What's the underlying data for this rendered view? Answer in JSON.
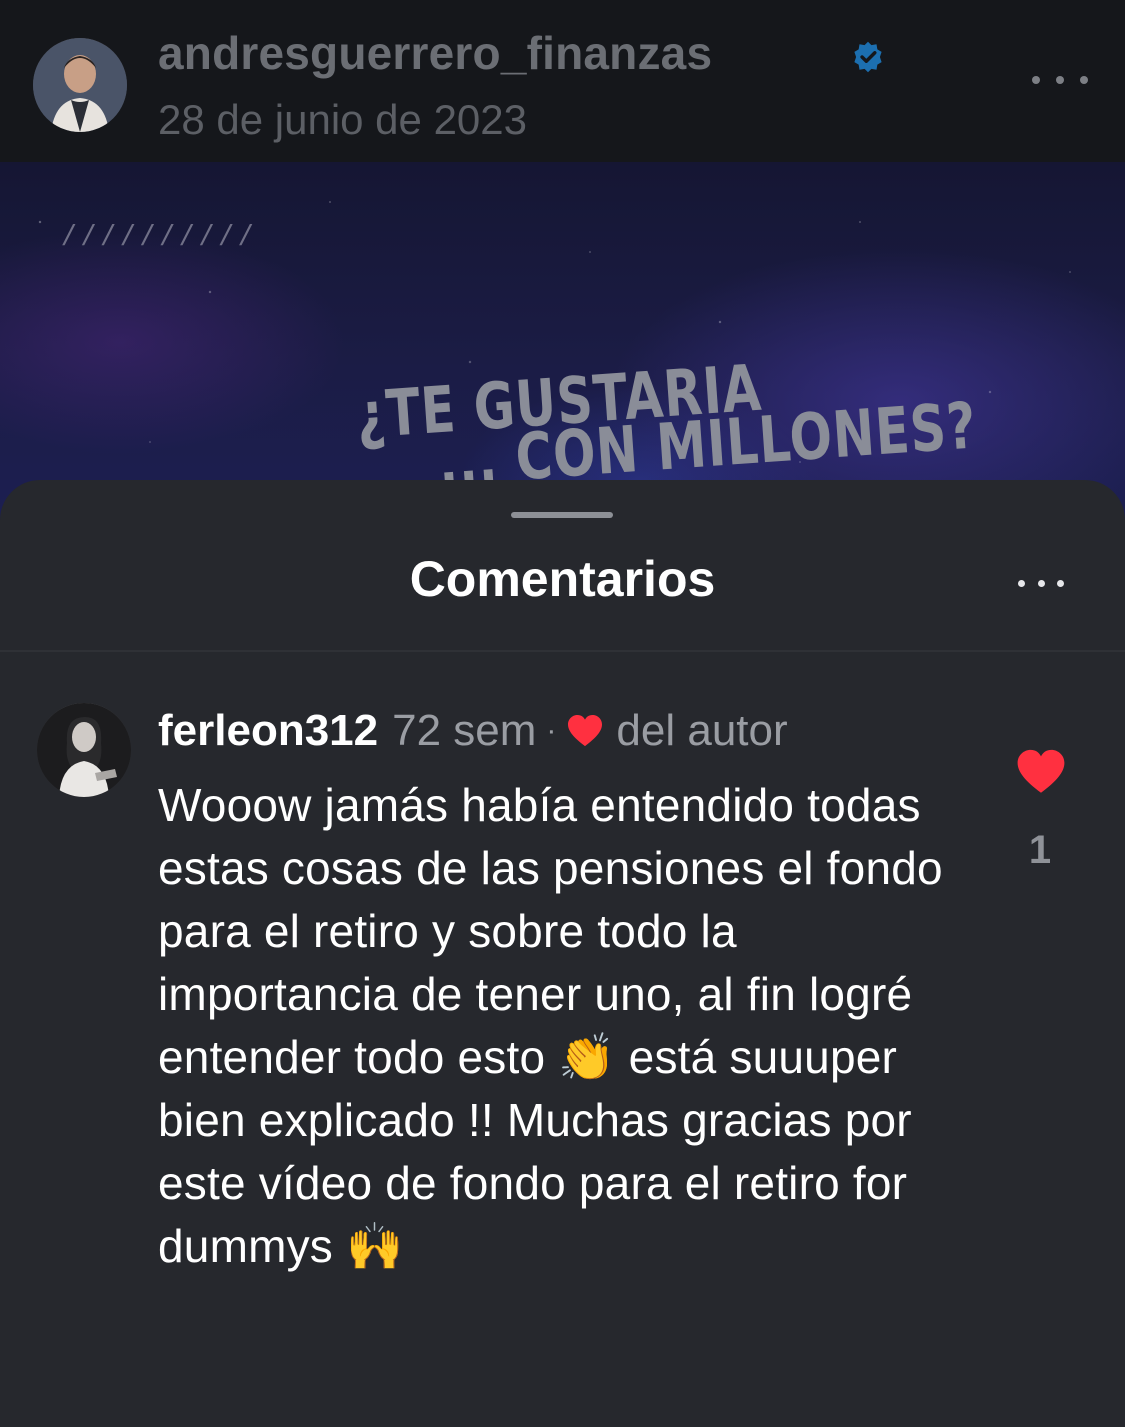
{
  "post": {
    "author": "andresguerrero_finanzas",
    "date": "28 de junio de 2023",
    "verified": true,
    "avatar_icon": "author-avatar"
  },
  "media": {
    "headline_line1": "¿TE GUSTARIA",
    "headline_line2": "... CON MILLONES?",
    "decoration": "//////////"
  },
  "sheet": {
    "title": "Comentarios"
  },
  "comment": {
    "username": "ferleon312",
    "time": "72 sem",
    "separator": "·",
    "liked_by_author_label": "del autor",
    "text": "Wooow jamás había entendido todas estas cosas de las pensiones el fondo para el retiro y sobre todo la importancia de tener uno, al fin logré entender todo esto 👏 está suuuper bien explicado !! Muchas gracias por este vídeo de fondo para el retiro for dummys 🙌",
    "like_count": "1"
  },
  "colors": {
    "heart": "#ff3040",
    "verified": "#0095f6",
    "sheet_bg": "#26282d"
  }
}
